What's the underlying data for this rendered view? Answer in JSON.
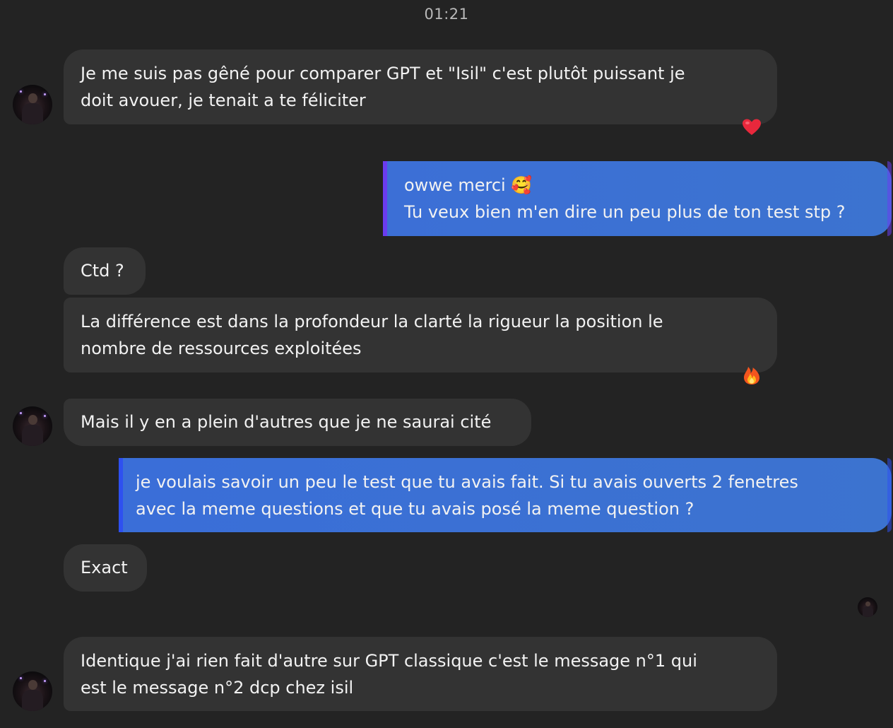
{
  "conversation": {
    "timestamp": "01:21",
    "messages": [
      {
        "from": "contact",
        "lines": [
          "Je me suis pas gêné pour comparer GPT et \"Isil\" c'est plutôt puissant je",
          "doit avouer, je tenait a te féliciter"
        ],
        "reaction": "heart-icon"
      },
      {
        "from": "me",
        "lines": [
          "owwe merci 🥰",
          "Tu veux bien m'en dire un peu plus de ton test stp ?"
        ]
      },
      {
        "from": "contact",
        "lines": [
          "Ctd ?"
        ]
      },
      {
        "from": "contact",
        "lines": [
          "La différence est dans la profondeur la clarté la rigueur la position le",
          "nombre de ressources exploitées"
        ],
        "reaction": "fire-icon"
      },
      {
        "from": "contact",
        "lines": [
          "Mais il y en a plein d'autres que je ne saurai cité"
        ]
      },
      {
        "from": "me",
        "lines": [
          "je voulais savoir un peu le test que tu avais fait. Si tu avais ouverts 2 fenetres",
          "avec la meme questions et que tu avais posé la meme question ?"
        ]
      },
      {
        "from": "contact",
        "lines": [
          "Exact"
        ]
      },
      {
        "from": "contact",
        "lines": [
          "Identique j'ai rien fait d'autre sur GPT classique c'est le message n°1 qui",
          "est le message n°2 dcp chez isil"
        ]
      }
    ]
  },
  "colors": {
    "background": "#232323",
    "incoming_bubble": "#333333",
    "outgoing_bubble": "#3c73cf",
    "text": "#f2f2f2",
    "timestamp": "#b9b9b9",
    "accent_purple": "#6a3cf0",
    "accent_blue": "#2e50f0"
  }
}
